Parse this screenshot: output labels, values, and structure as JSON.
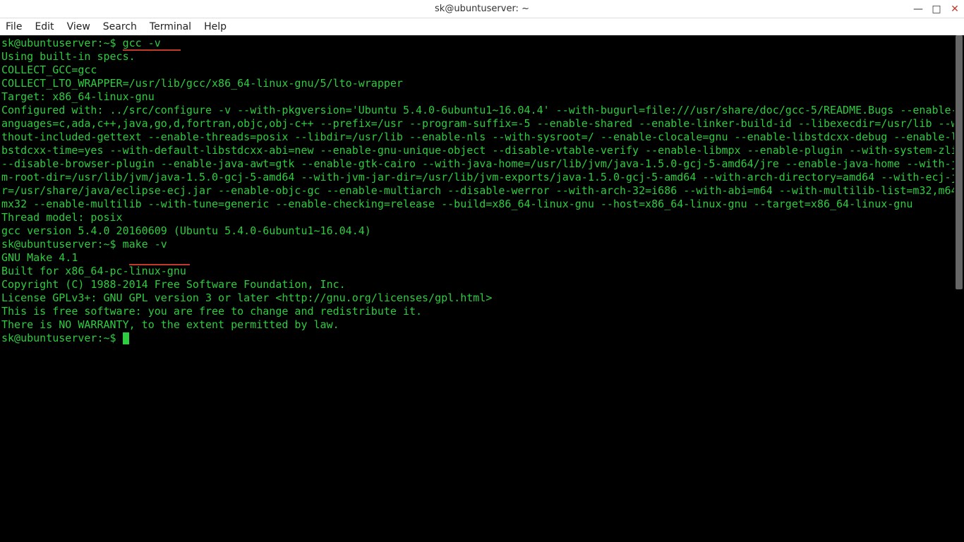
{
  "window": {
    "title": "sk@ubuntuserver: ~"
  },
  "menu": {
    "file": "File",
    "edit": "Edit",
    "view": "View",
    "search": "Search",
    "terminal": "Terminal",
    "help": "Help"
  },
  "term": {
    "prompt1_user": "sk@ubuntuserver",
    "prompt1_path": "~",
    "cmd1": "gcc -v",
    "out1": "Using built-in specs.",
    "out2": "COLLECT_GCC=gcc",
    "out3": "COLLECT_LTO_WRAPPER=/usr/lib/gcc/x86_64-linux-gnu/5/lto-wrapper",
    "out4": "Target: x86_64-linux-gnu",
    "out5": "Configured with: ../src/configure -v --with-pkgversion='Ubuntu 5.4.0-6ubuntu1~16.04.4' --with-bugurl=file:///usr/share/doc/gcc-5/README.Bugs --enable-languages=c,ada,c++,java,go,d,fortran,objc,obj-c++ --prefix=/usr --program-suffix=-5 --enable-shared --enable-linker-build-id --libexecdir=/usr/lib --without-included-gettext --enable-threads=posix --libdir=/usr/lib --enable-nls --with-sysroot=/ --enable-clocale=gnu --enable-libstdcxx-debug --enable-libstdcxx-time=yes --with-default-libstdcxx-abi=new --enable-gnu-unique-object --disable-vtable-verify --enable-libmpx --enable-plugin --with-system-zlib --disable-browser-plugin --enable-java-awt=gtk --enable-gtk-cairo --with-java-home=/usr/lib/jvm/java-1.5.0-gcj-5-amd64/jre --enable-java-home --with-jvm-root-dir=/usr/lib/jvm/java-1.5.0-gcj-5-amd64 --with-jvm-jar-dir=/usr/lib/jvm-exports/java-1.5.0-gcj-5-amd64 --with-arch-directory=amd64 --with-ecj-jar=/usr/share/java/eclipse-ecj.jar --enable-objc-gc --enable-multiarch --disable-werror --with-arch-32=i686 --with-abi=m64 --with-multilib-list=m32,m64,mx32 --enable-multilib --with-tune=generic --enable-checking=release --build=x86_64-linux-gnu --host=x86_64-linux-gnu --target=x86_64-linux-gnu",
    "out6": "Thread model: posix",
    "out7": "gcc version 5.4.0 20160609 (Ubuntu 5.4.0-6ubuntu1~16.04.4)",
    "prompt2_user": "sk@ubuntuserver",
    "prompt2_path": "~",
    "cmd2": "make -v",
    "out8": "GNU Make 4.1",
    "out9": "Built for x86_64-pc-linux-gnu",
    "out10": "Copyright (C) 1988-2014 Free Software Foundation, Inc.",
    "out11": "License GPLv3+: GNU GPL version 3 or later <http://gnu.org/licenses/gpl.html>",
    "out12": "This is free software: you are free to change and redistribute it.",
    "out13": "There is NO WARRANTY, to the extent permitted by law.",
    "prompt3_user": "sk@ubuntuserver",
    "prompt3_path": "~"
  }
}
